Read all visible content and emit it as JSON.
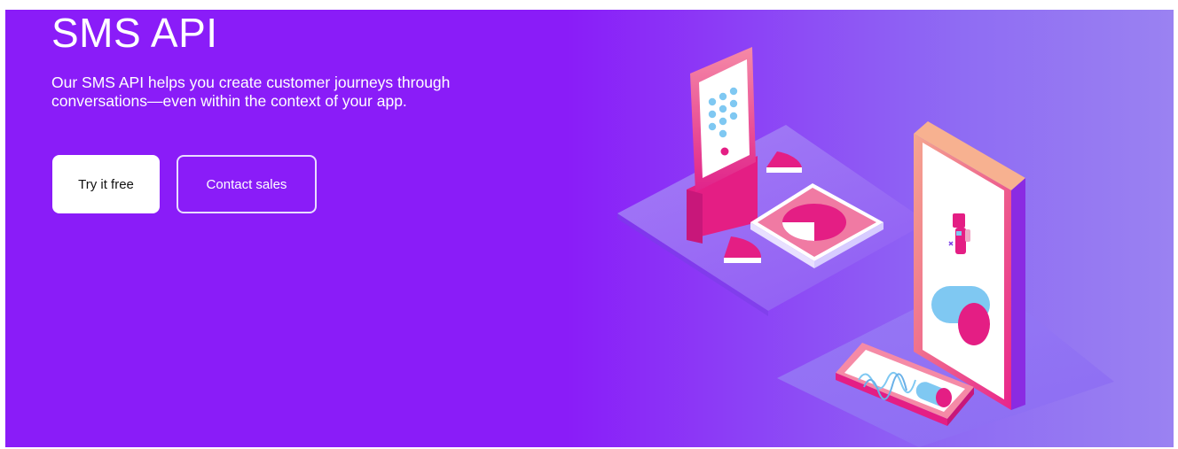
{
  "hero": {
    "title": "SMS API",
    "subtitle": "Our SMS API helps you create customer journeys through conversations—even within the context of your app.",
    "primary_button": "Try it free",
    "secondary_button": "Contact sales"
  },
  "colors": {
    "background": "#8a1cf8",
    "primary_button_bg": "#ffffff",
    "accent_pink": "#e91e8c",
    "accent_blue": "#7fc8f2"
  }
}
